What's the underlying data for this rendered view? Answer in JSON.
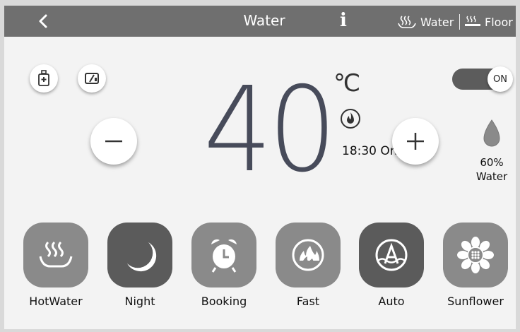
{
  "header": {
    "back_label": "<",
    "title": "Water",
    "info_label": "i",
    "water_mode_label": "Water",
    "floor_mode_label": "Floor"
  },
  "temperature": {
    "value": "40",
    "unit": "℃"
  },
  "timer": {
    "text": "18:30 On"
  },
  "power": {
    "state_label": "ON"
  },
  "water_level": {
    "percent": "60%",
    "label": "Water"
  },
  "modes": [
    {
      "label": "HotWater",
      "icon": "hot-water-icon",
      "color": "#8a8a8a"
    },
    {
      "label": "Night",
      "icon": "moon-icon",
      "color": "#5b5b5b"
    },
    {
      "label": "Booking",
      "icon": "alarm-clock-icon",
      "color": "#8a8a8a"
    },
    {
      "label": "Fast",
      "icon": "flame-circle-icon",
      "color": "#8a8a8a"
    },
    {
      "label": "Auto",
      "icon": "auto-a-icon",
      "color": "#5b5b5b"
    },
    {
      "label": "Sunflower",
      "icon": "sunflower-icon",
      "color": "#8a8a8a"
    }
  ],
  "colors": {
    "header_bg": "#6f6f6f",
    "panel_bg": "#f3f3f3",
    "temp_text": "#474b5a"
  }
}
